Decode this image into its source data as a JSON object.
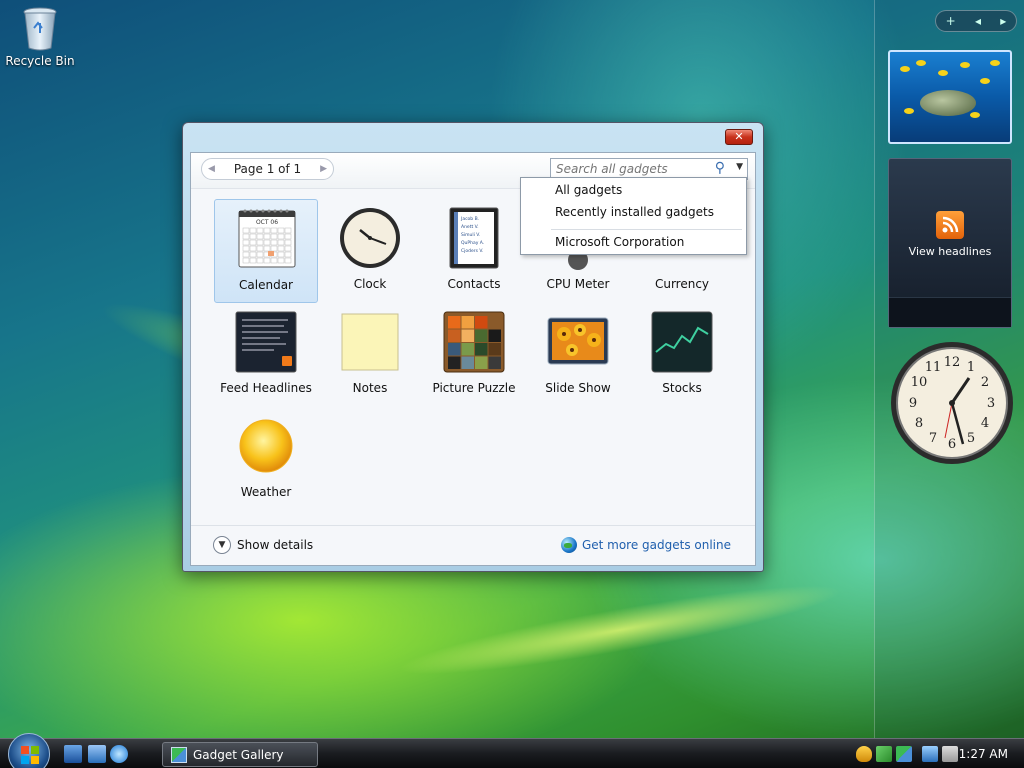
{
  "desktop": {
    "recycle_bin_label": "Recycle Bin"
  },
  "sidebar": {
    "controls": {
      "add": "+",
      "prev": "◂",
      "next": "▸"
    },
    "feed_label": "View headlines"
  },
  "window": {
    "close_glyph": "✕",
    "pager_text": "Page 1 of 1",
    "search_placeholder": "Search all gadgets",
    "dropdown_items": [
      "All gadgets",
      "Recently installed gadgets",
      "Microsoft Corporation"
    ],
    "gadgets": [
      {
        "name": "Calendar",
        "icon": "calendar-icon",
        "selected": true
      },
      {
        "name": "Clock",
        "icon": "clock-icon"
      },
      {
        "name": "Contacts",
        "icon": "contacts-icon"
      },
      {
        "name": "CPU Meter",
        "icon": "cpu-meter-icon"
      },
      {
        "name": "Currency",
        "icon": "currency-icon"
      },
      {
        "name": "Feed Headlines",
        "icon": "feed-headlines-icon"
      },
      {
        "name": "Notes",
        "icon": "notes-icon"
      },
      {
        "name": "Picture Puzzle",
        "icon": "picture-puzzle-icon"
      },
      {
        "name": "Slide Show",
        "icon": "slide-show-icon"
      },
      {
        "name": "Stocks",
        "icon": "stocks-icon"
      },
      {
        "name": "Weather",
        "icon": "weather-icon"
      }
    ],
    "calendar_month": "OCT 06",
    "contacts_lines": [
      "Jacob B.",
      "Anett V.",
      "Simuli V.",
      "QuPhay A.",
      "Cjoders V."
    ],
    "show_details": "Show details",
    "get_more": "Get more gadgets online"
  },
  "taskbar": {
    "task_label": "Gadget Gallery",
    "time": "1:27 AM"
  },
  "colors": {
    "link": "#1f5fad",
    "selection": "#cfe4f7",
    "close_red": "#c8321c"
  }
}
